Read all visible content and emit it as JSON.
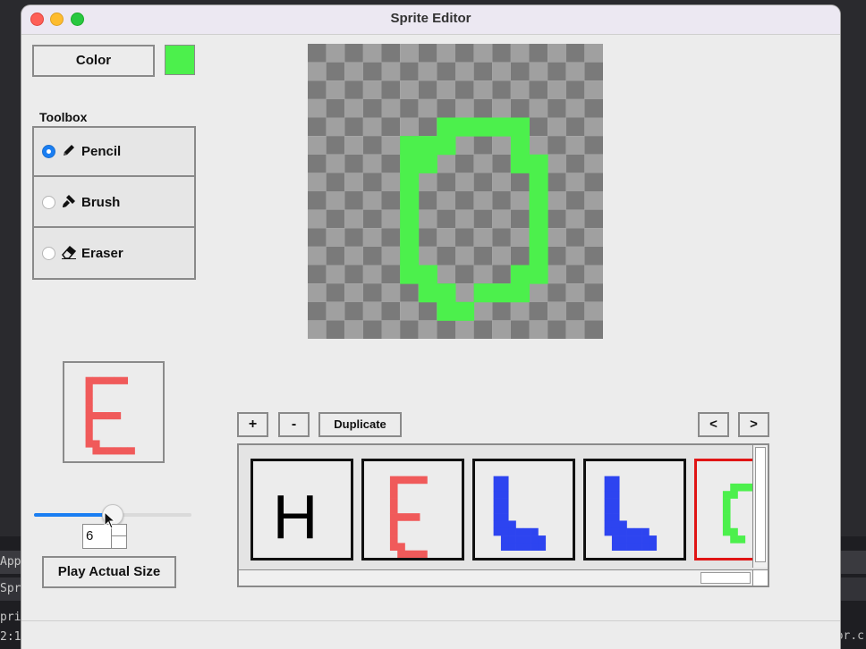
{
  "window": {
    "title": "Sprite Editor"
  },
  "background_terminal": {
    "lines": [
      "Appl",
      "Spri",
      "pri",
      "2:1"
    ],
    "tail_text": "or.c"
  },
  "color": {
    "button_label": "Color",
    "current": "#4cf04c"
  },
  "toolbox": {
    "label": "Toolbox",
    "tools": [
      {
        "label": "Pencil",
        "icon": "pencil-icon",
        "selected": true
      },
      {
        "label": "Brush",
        "icon": "brush-icon",
        "selected": false
      },
      {
        "label": "Eraser",
        "icon": "eraser-icon",
        "selected": false
      }
    ]
  },
  "canvas": {
    "grid_size": 16,
    "checker_light": "#a0a0a0",
    "checker_dark": "#7a7a7a",
    "pixel_color": "#4cf04c",
    "pixels": [
      [
        7,
        4
      ],
      [
        8,
        4
      ],
      [
        9,
        4
      ],
      [
        10,
        4
      ],
      [
        11,
        4
      ],
      [
        5,
        5
      ],
      [
        6,
        5
      ],
      [
        7,
        5
      ],
      [
        11,
        5
      ],
      [
        5,
        6
      ],
      [
        6,
        6
      ],
      [
        11,
        6
      ],
      [
        12,
        6
      ],
      [
        5,
        7
      ],
      [
        12,
        7
      ],
      [
        5,
        8
      ],
      [
        12,
        8
      ],
      [
        5,
        9
      ],
      [
        12,
        9
      ],
      [
        5,
        10
      ],
      [
        12,
        10
      ],
      [
        5,
        11
      ],
      [
        12,
        11
      ],
      [
        5,
        12
      ],
      [
        6,
        12
      ],
      [
        11,
        12
      ],
      [
        12,
        12
      ],
      [
        6,
        13
      ],
      [
        7,
        13
      ],
      [
        9,
        13
      ],
      [
        10,
        13
      ],
      [
        11,
        13
      ],
      [
        7,
        14
      ],
      [
        8,
        14
      ]
    ]
  },
  "preview": {
    "letter_color": "#f05a5a",
    "pixels": [
      [
        3,
        2
      ],
      [
        4,
        2
      ],
      [
        5,
        2
      ],
      [
        6,
        2
      ],
      [
        7,
        2
      ],
      [
        8,
        2
      ],
      [
        3,
        3
      ],
      [
        3,
        4
      ],
      [
        3,
        5
      ],
      [
        3,
        6
      ],
      [
        3,
        7
      ],
      [
        4,
        7
      ],
      [
        5,
        7
      ],
      [
        6,
        7
      ],
      [
        7,
        7
      ],
      [
        3,
        8
      ],
      [
        3,
        9
      ],
      [
        3,
        10
      ],
      [
        3,
        11
      ],
      [
        4,
        11
      ],
      [
        4,
        12
      ],
      [
        5,
        12
      ],
      [
        6,
        12
      ],
      [
        7,
        12
      ],
      [
        8,
        12
      ],
      [
        9,
        12
      ]
    ]
  },
  "speed": {
    "value": 6,
    "min": 0,
    "max": 12,
    "spin_text": "6"
  },
  "play_button_label": "Play Actual Size",
  "frame_controls": {
    "add_label": "+",
    "remove_label": "-",
    "duplicate_label": "Duplicate",
    "prev_label": "<",
    "next_label": ">"
  },
  "frames": [
    {
      "text": "H",
      "color": "#000000",
      "type": "text",
      "selected": false
    },
    {
      "type": "pixels",
      "color": "#f05a5a",
      "selected": false
    },
    {
      "type": "pixels",
      "color": "#2d44f0",
      "selected": false
    },
    {
      "type": "pixels",
      "color": "#2d44f0",
      "selected": false
    },
    {
      "type": "pixels",
      "color": "#4cf04c",
      "selected": true
    }
  ]
}
